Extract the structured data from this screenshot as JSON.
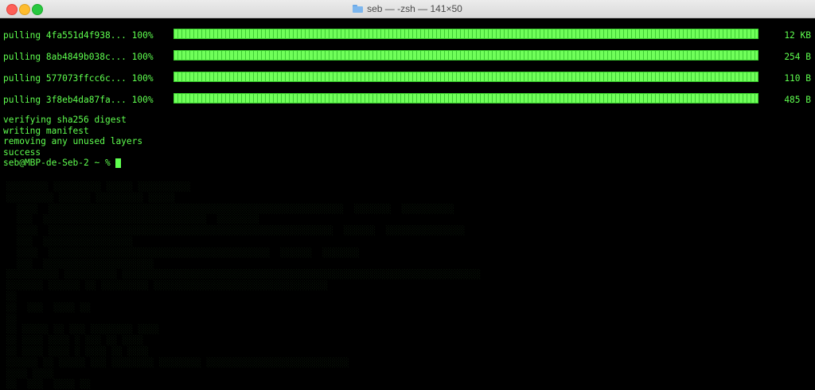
{
  "window": {
    "title": "seb — -zsh — 141×50"
  },
  "terminal": {
    "pulls": [
      {
        "label": "pulling 4fa551d4f938... 100%",
        "progress": 1.0,
        "size": "12 KB"
      },
      {
        "label": "pulling 8ab4849b038c... 100%",
        "progress": 1.0,
        "size": "254 B"
      },
      {
        "label": "pulling 577073ffcc6c... 100%",
        "progress": 1.0,
        "size": "110 B"
      },
      {
        "label": "pulling 3f8eb4da87fa... 100%",
        "progress": 1.0,
        "size": "485 B"
      }
    ],
    "lines": [
      "verifying sha256 digest",
      "writing manifest",
      "removing any unused layers",
      "success"
    ],
    "prompt": "seb@MBP-de-Seb-2 ~ %"
  }
}
